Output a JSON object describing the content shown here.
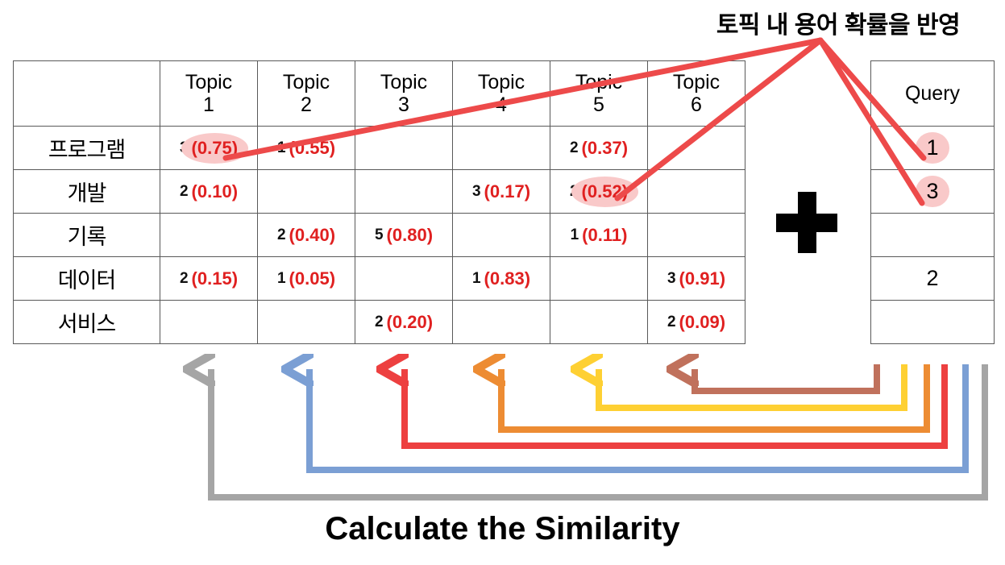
{
  "captions": {
    "top": "토픽 내 용어 확률을 반영",
    "bottom": "Calculate the Similarity"
  },
  "matrix": {
    "corner_label": "",
    "topic_headers": [
      {
        "line1": "Topic",
        "line2": "1"
      },
      {
        "line1": "Topic",
        "line2": "2"
      },
      {
        "line1": "Topic",
        "line2": "3"
      },
      {
        "line1": "Topic",
        "line2": "4"
      },
      {
        "line1": "Topic",
        "line2": "5"
      },
      {
        "line1": "Topic",
        "line2": "6"
      }
    ],
    "rows": [
      {
        "term": "프로그램",
        "cells": [
          {
            "count": "3",
            "prob": "(0.75)",
            "highlight": true
          },
          {
            "count": "1",
            "prob": "(0.55)",
            "highlight": false
          },
          {
            "count": "",
            "prob": "",
            "highlight": false
          },
          {
            "count": "",
            "prob": "",
            "highlight": false
          },
          {
            "count": "2",
            "prob": "(0.37)",
            "highlight": false
          },
          {
            "count": "",
            "prob": "",
            "highlight": false
          }
        ]
      },
      {
        "term": "개발",
        "cells": [
          {
            "count": "2",
            "prob": "(0.10)",
            "highlight": false
          },
          {
            "count": "",
            "prob": "",
            "highlight": false
          },
          {
            "count": "",
            "prob": "",
            "highlight": false
          },
          {
            "count": "3",
            "prob": "(0.17)",
            "highlight": false
          },
          {
            "count": "2",
            "prob": "(0.52)",
            "highlight": true
          },
          {
            "count": "",
            "prob": "",
            "highlight": false
          }
        ]
      },
      {
        "term": "기록",
        "cells": [
          {
            "count": "",
            "prob": "",
            "highlight": false
          },
          {
            "count": "2",
            "prob": "(0.40)",
            "highlight": false
          },
          {
            "count": "5",
            "prob": "(0.80)",
            "highlight": false
          },
          {
            "count": "",
            "prob": "",
            "highlight": false
          },
          {
            "count": "1",
            "prob": "(0.11)",
            "highlight": false
          },
          {
            "count": "",
            "prob": "",
            "highlight": false
          }
        ]
      },
      {
        "term": "데이터",
        "cells": [
          {
            "count": "2",
            "prob": "(0.15)",
            "highlight": false
          },
          {
            "count": "1",
            "prob": "(0.05)",
            "highlight": false
          },
          {
            "count": "",
            "prob": "",
            "highlight": false
          },
          {
            "count": "1",
            "prob": "(0.83)",
            "highlight": false
          },
          {
            "count": "",
            "prob": "",
            "highlight": false
          },
          {
            "count": "3",
            "prob": "(0.91)",
            "highlight": false
          }
        ]
      },
      {
        "term": "서비스",
        "cells": [
          {
            "count": "",
            "prob": "",
            "highlight": false
          },
          {
            "count": "",
            "prob": "",
            "highlight": false
          },
          {
            "count": "2",
            "prob": "(0.20)",
            "highlight": false
          },
          {
            "count": "",
            "prob": "",
            "highlight": false
          },
          {
            "count": "",
            "prob": "",
            "highlight": false
          },
          {
            "count": "2",
            "prob": "(0.09)",
            "highlight": false
          }
        ]
      }
    ]
  },
  "query": {
    "header": "Query",
    "values": [
      {
        "value": "1",
        "highlight": true
      },
      {
        "value": "3",
        "highlight": true
      },
      {
        "value": "",
        "highlight": false
      },
      {
        "value": "2",
        "highlight": false
      },
      {
        "value": "",
        "highlight": false
      }
    ]
  },
  "operator": {
    "symbol": "plus-sign"
  },
  "colors": {
    "highlight_line": "#ed4a4a",
    "highlight_ellipse": "#f9c9c9",
    "prob_text": "#e02020",
    "table_border": "#595959",
    "connector_topic1": "#a5a5a5",
    "connector_topic2": "#7b9fd4",
    "connector_topic3": "#ed4040",
    "connector_topic4": "#ed8c33",
    "connector_topic5": "#fed033",
    "connector_topic6": "#c0715c"
  },
  "connectors": [
    {
      "name": "topic-1-similarity-connector",
      "color": "#a5a5a5"
    },
    {
      "name": "topic-2-similarity-connector",
      "color": "#7b9fd4"
    },
    {
      "name": "topic-3-similarity-connector",
      "color": "#ed4040"
    },
    {
      "name": "topic-4-similarity-connector",
      "color": "#ed8c33"
    },
    {
      "name": "topic-5-similarity-connector",
      "color": "#fed033"
    },
    {
      "name": "topic-6-similarity-connector",
      "color": "#c0715c"
    }
  ]
}
